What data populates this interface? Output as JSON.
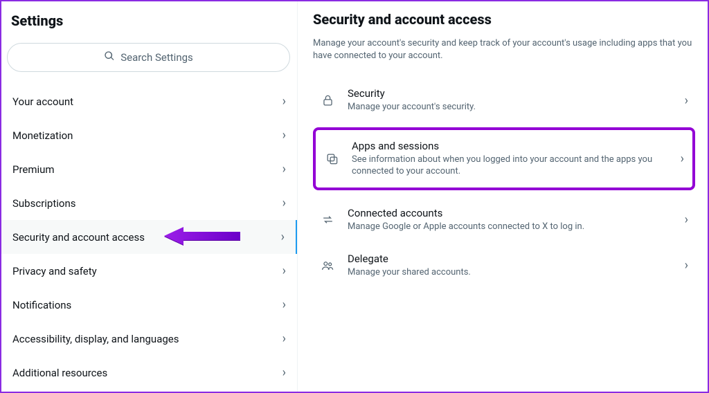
{
  "sidebar": {
    "title": "Settings",
    "search_placeholder": "Search Settings",
    "items": [
      {
        "label": "Your account"
      },
      {
        "label": "Monetization"
      },
      {
        "label": "Premium"
      },
      {
        "label": "Subscriptions"
      },
      {
        "label": "Security and account access"
      },
      {
        "label": "Privacy and safety"
      },
      {
        "label": "Notifications"
      },
      {
        "label": "Accessibility, display, and languages"
      },
      {
        "label": "Additional resources"
      }
    ]
  },
  "main": {
    "title": "Security and account access",
    "lead": "Manage your account's security and keep track of your account's usage including apps that you have connected to your account.",
    "rows": [
      {
        "title": "Security",
        "desc": "Manage your account's security."
      },
      {
        "title": "Apps and sessions",
        "desc": "See information about when you logged into your account and the apps you connected to your account."
      },
      {
        "title": "Connected accounts",
        "desc": "Manage Google or Apple accounts connected to X to log in."
      },
      {
        "title": "Delegate",
        "desc": "Manage your shared accounts."
      }
    ]
  }
}
